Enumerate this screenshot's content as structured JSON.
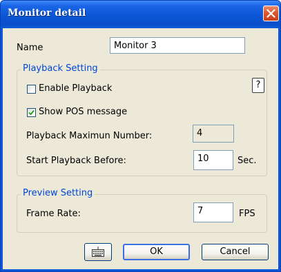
{
  "window": {
    "title": "Monitor detail",
    "close_icon": "close-icon"
  },
  "name_field": {
    "label": "Name",
    "value": "Monitor 3"
  },
  "playback_setting": {
    "caption": "Playback Setting",
    "enable_playback": {
      "label": "Enable Playback",
      "checked": false
    },
    "help_button": {
      "label": "?"
    },
    "show_pos": {
      "label": "Show POS message",
      "checked": true
    },
    "max_number": {
      "label": "Playback Maximun Number:",
      "value": "4"
    },
    "start_before": {
      "label": "Start Playback Before:",
      "value": "10",
      "unit": "Sec."
    }
  },
  "preview_setting": {
    "caption": "Preview Setting",
    "frame_rate": {
      "label": "Frame Rate:",
      "value": "7",
      "unit": "FPS"
    }
  },
  "buttons": {
    "keyboard_icon": "keyboard-icon",
    "ok": "OK",
    "cancel": "Cancel"
  },
  "colors": {
    "titlebar": "#0b58d8",
    "client_bg": "#ece9d8",
    "group_caption": "#0046d5",
    "close_button": "#e1552b"
  }
}
